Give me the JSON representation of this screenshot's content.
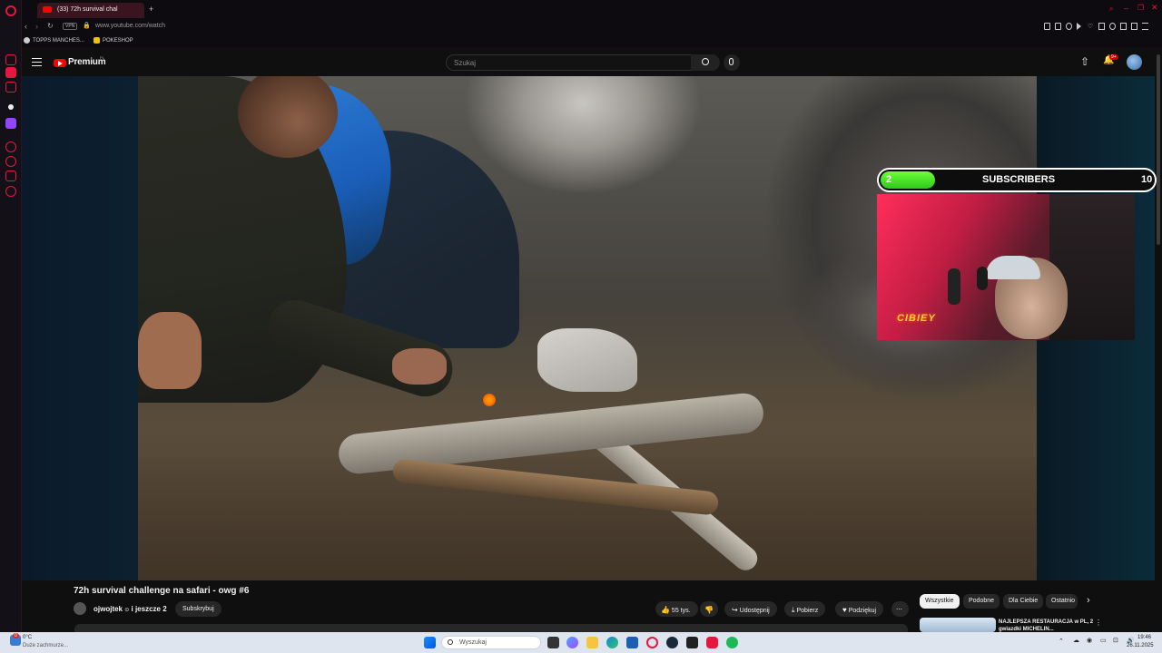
{
  "browser": {
    "tab_title": "(33) 72h survival chal",
    "vpn": "VPN",
    "url": "www.youtube.com/watch",
    "bookmarks": [
      {
        "label": "TOPPS MANCHES..."
      },
      {
        "label": "POKESHOP"
      }
    ]
  },
  "youtube": {
    "logo": "Premium",
    "logo_region": "PL",
    "search_placeholder": "Szukaj",
    "notif_badge": "9+"
  },
  "overlay": {
    "subscribers_current": "2",
    "subscribers_label": "SUBSCRIBERS",
    "subscribers_goal": "10",
    "subscribers_progress": 0.2,
    "webcam_sign": "CIBIEY"
  },
  "video": {
    "title": "72h survival challenge na safari - owg #6",
    "channel": "ojwojtek",
    "channel_extra": "i jeszcze 2",
    "subscribe": "Subskrybuj",
    "likes": "55 tys.",
    "share": "Udostępnij",
    "download": "Pobierz",
    "thanks": "Podziękuj"
  },
  "chips": [
    {
      "label": "Wszystkie",
      "active": true
    },
    {
      "label": "Podobne",
      "active": false
    },
    {
      "label": "Dla Ciebie",
      "active": false
    },
    {
      "label": "Ostatnio",
      "active": false
    }
  ],
  "recommended": {
    "title": "NAJLEPSZA RESTAURACJA w PL, 2 gwiazdki MICHELIN..."
  },
  "taskbar": {
    "weather_badge": "0",
    "temperature": "0°C",
    "weather_desc": "Duże zachmurze...",
    "search": "Wyszukaj",
    "time": "19:46",
    "date": "26.11.2025"
  },
  "colors": {
    "accent_red": "#ff0000",
    "opera_red": "#e5173f",
    "sub_fill": "#4be32a"
  }
}
